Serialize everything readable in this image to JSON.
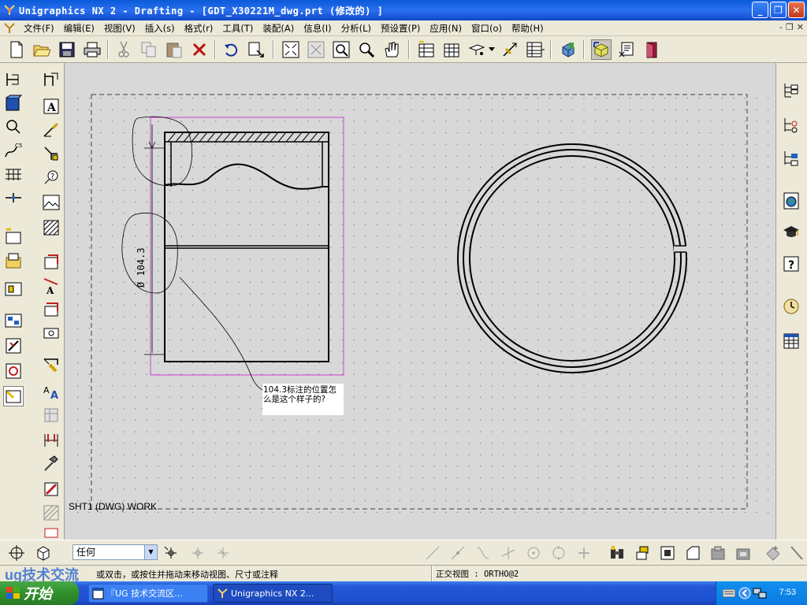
{
  "window": {
    "title": "Unigraphics NX 2 - Drafting - [GDT_X30221M_dwg.prt  (修改的) ]",
    "minimize": "_",
    "maximize": "❐",
    "close": "✕"
  },
  "menu": {
    "items": [
      {
        "label": "文件(F)"
      },
      {
        "label": "编辑(E)"
      },
      {
        "label": "视图(V)"
      },
      {
        "label": "插入(s)"
      },
      {
        "label": "格式(r)"
      },
      {
        "label": "工具(T)"
      },
      {
        "label": "装配(A)"
      },
      {
        "label": "信息(I)"
      },
      {
        "label": "分析(L)"
      },
      {
        "label": "预设置(P)"
      },
      {
        "label": "应用(N)"
      },
      {
        "label": "窗口(o)"
      },
      {
        "label": "帮助(H)"
      }
    ],
    "mdi_min": "-",
    "mdi_restore": "❐",
    "mdi_close": "✕"
  },
  "toolbar": {
    "icons": [
      "new-icon",
      "open-icon",
      "save-icon",
      "print-icon",
      "cut-icon",
      "copy-icon",
      "paste-icon",
      "delete-icon",
      "undo-icon",
      "repeat-command-icon",
      "fit-icon",
      "zoom-window-icon",
      "zoom-area-icon",
      "zoom-icon",
      "pan-icon",
      "annotation-editor-icon",
      "drawing-sheet-icon",
      "preferences-icon",
      "dimension-icon",
      "table-icon",
      "modeling-icon",
      "drafting-icon",
      "view-icon",
      "door-icon"
    ]
  },
  "drawing": {
    "sheet_label": "SHT1 (DWG) WORK",
    "dimension_text": "Ø 104.3",
    "note_line1": "104.3标注的位置怎",
    "note_line2": "么是这个样子的?"
  },
  "bottom_toolbar": {
    "select_filter": "任何"
  },
  "status": {
    "left": "或双击，或按住并拖动来移动视图、尺寸或注释",
    "right": "正交视图 : ORTHO@2",
    "watermark": "ug技术交流"
  },
  "taskbar": {
    "start_label": "开始",
    "task1": "『UG 技术交流区...",
    "task2": "Unigraphics NX 2...",
    "clock": "7:53"
  },
  "colors": {
    "title_bar": "#1048c8",
    "magenta_border": "#d040d0",
    "graphics_bg": "#d8d8d8"
  }
}
